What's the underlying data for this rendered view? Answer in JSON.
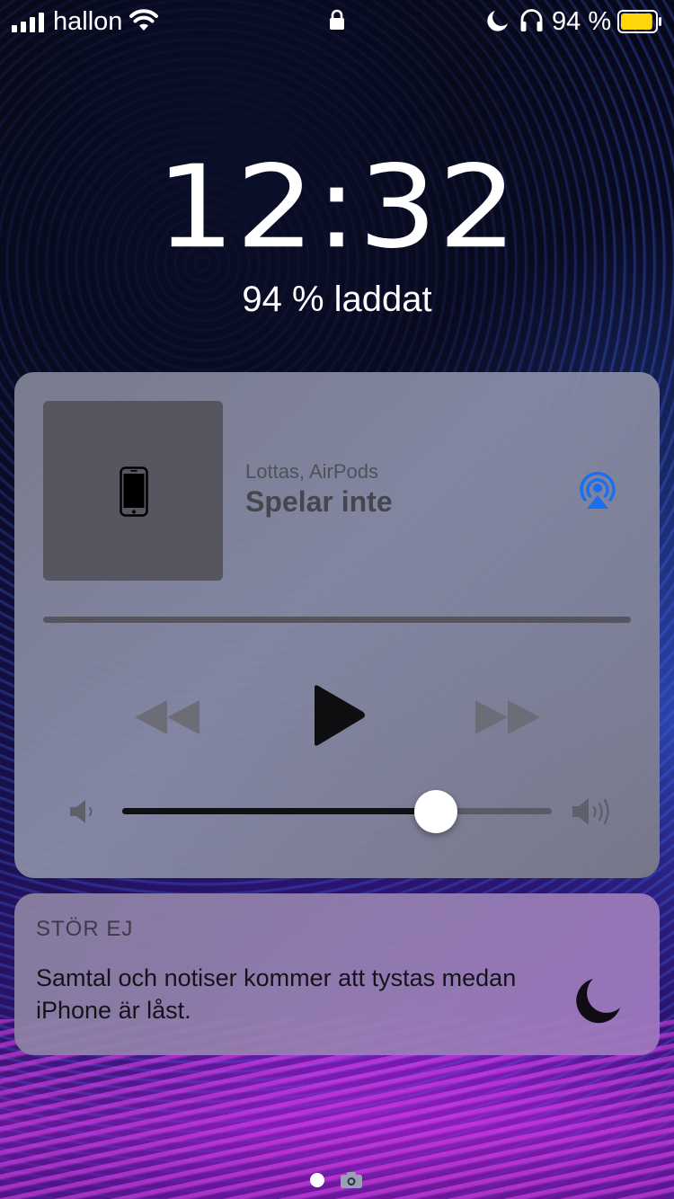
{
  "status_bar": {
    "carrier": "hallon",
    "battery_percent_label": "94 %",
    "battery_level": 0.94,
    "icons": [
      "signal-icon",
      "wifi-icon",
      "lock-icon",
      "moon-icon",
      "headphones-icon",
      "battery-icon"
    ]
  },
  "lockscreen": {
    "time": "12:32",
    "charge_status": "94 % laddat"
  },
  "media_player": {
    "device_name": "Lottas, AirPods",
    "track_status": "Spelar inte",
    "volume_level": 0.73,
    "accent_color": "#1a6ff0",
    "icons": [
      "phone-icon",
      "airplay-icon",
      "rewind-icon",
      "play-icon",
      "fast-forward-icon",
      "volume-low-icon",
      "volume-high-icon"
    ]
  },
  "dnd_notification": {
    "title": "STÖR EJ",
    "message": "Samtal och notiser kommer att tystas medan iPhone är låst.",
    "icon": "moon-icon"
  },
  "page_indicator": {
    "icons": [
      "page-dot",
      "camera-icon"
    ]
  }
}
